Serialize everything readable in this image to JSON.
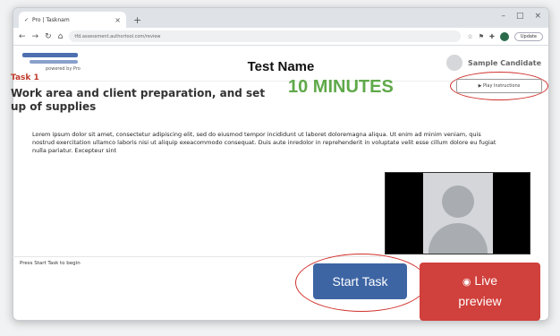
{
  "browser": {
    "tab_title": "Pro | Tasknam",
    "tab_close": "×",
    "new_tab": "+",
    "window_controls": [
      "–",
      "□",
      "×"
    ],
    "url": "tfd.assessment.authortool.com/review",
    "update_label": "Update"
  },
  "header": {
    "logo_subtext": "powered by Pro",
    "title": "Test Name",
    "candidate_name": "Sample Candidate"
  },
  "task": {
    "label": "Task 1",
    "title": "Work area and client preparation, and set up of supplies",
    "timer": "10 MINUTES",
    "play_instructions": "▶ Play Instructions",
    "description": "Lorem ipsum dolor sit amet, consectetur adipiscing elit, sed do eiusmod tempor incididunt ut laboret doloremagna aliqua. Ut enim ad minim veniam, quis nostrud exercitation ullamco laboris nisi ut aliquip exeacommodo consequat. Duis aute inredolor in reprehenderit in voluptate velit esse cillum dolore eu fugiat nulla pariatur. Excepteur sint"
  },
  "footer": {
    "prompt": "Press Start Task to begin",
    "start_button": "Start Task",
    "live_preview_line1": "Live",
    "live_preview_line2": "preview"
  },
  "colors": {
    "task_red": "#c0392b",
    "timer_green": "#5fa94a",
    "start_blue": "#3d65a4",
    "live_red": "#d0403c",
    "annotation_red": "#d0312d"
  }
}
